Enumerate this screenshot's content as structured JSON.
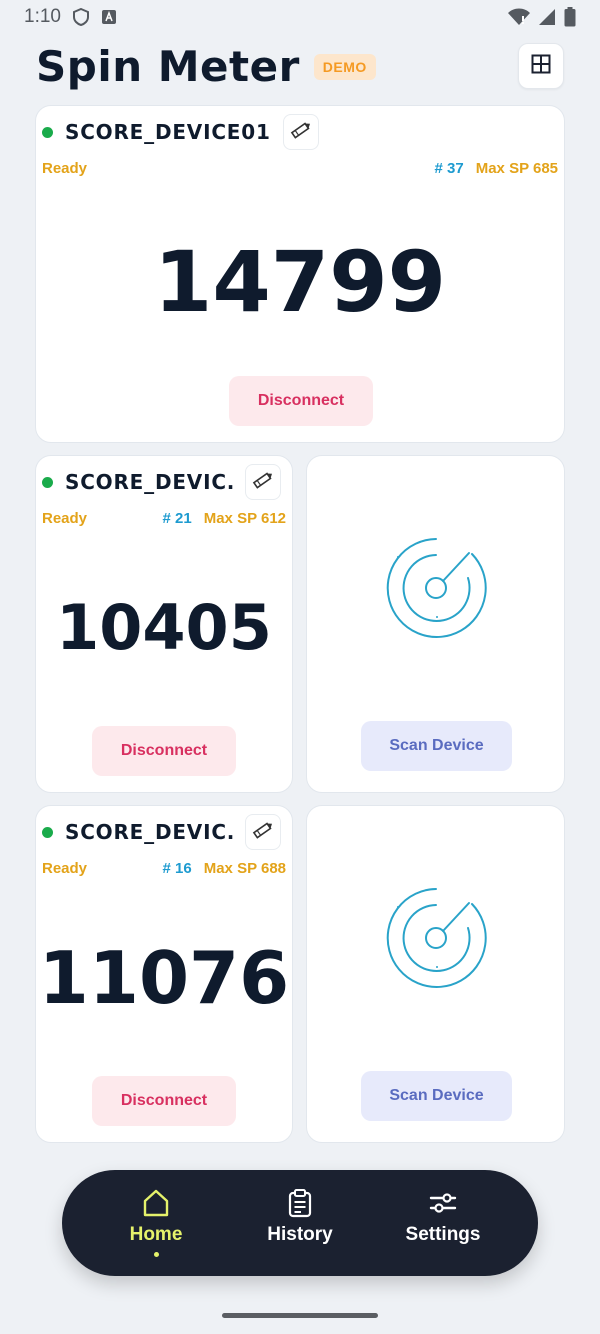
{
  "status_bar": {
    "time": "1:10"
  },
  "header": {
    "title": "Spin Meter",
    "badge": "DEMO"
  },
  "devices": [
    {
      "name": "SCORE_DEVICE01",
      "status": "Ready",
      "count": "# 37",
      "max_sp": "Max SP 685",
      "score": "14799",
      "action": "Disconnect"
    },
    {
      "name": "SCORE_DEVIC...",
      "status": "Ready",
      "count": "# 21",
      "max_sp": "Max SP 612",
      "score": "10405",
      "action": "Disconnect"
    },
    {
      "name": "SCORE_DEVIC...",
      "status": "Ready",
      "count": "# 16",
      "max_sp": "Max SP 688",
      "score": "11076",
      "action": "Disconnect"
    }
  ],
  "scan_slots": [
    {
      "action": "Scan Device"
    },
    {
      "action": "Scan Device"
    }
  ],
  "nav": {
    "items": [
      {
        "label": "Home",
        "icon": "home-icon",
        "active": true
      },
      {
        "label": "History",
        "icon": "clipboard-icon",
        "active": false
      },
      {
        "label": "Settings",
        "icon": "sliders-icon",
        "active": false
      }
    ]
  },
  "colors": {
    "background": "#eef1f5",
    "accent_yellow": "#e5f26b",
    "ready": "#e3a31a",
    "count": "#1e9bd0",
    "disconnect": "#d83060",
    "scan": "#5a6cc0",
    "connected_dot": "#1aab4b",
    "nav_bg": "#1b2130"
  }
}
